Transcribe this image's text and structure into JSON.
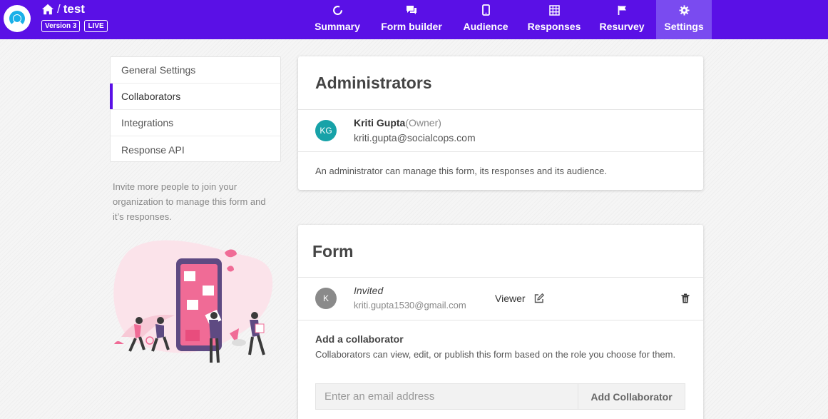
{
  "header": {
    "form_name": "test",
    "version_badge": "Version 3",
    "live_badge": "LIVE",
    "crumb_separator": "/"
  },
  "nav": [
    {
      "label": "Summary",
      "icon": "summary-icon"
    },
    {
      "label": "Form builder",
      "icon": "chat-icon"
    },
    {
      "label": "Audience",
      "icon": "phone-icon"
    },
    {
      "label": "Responses",
      "icon": "grid-icon"
    },
    {
      "label": "Resurvey",
      "icon": "flag-icon"
    },
    {
      "label": "Settings",
      "icon": "gear-icon",
      "active": true
    }
  ],
  "sidebar": {
    "items": [
      {
        "label": "General Settings"
      },
      {
        "label": "Collaborators",
        "active": true
      },
      {
        "label": "Integrations"
      },
      {
        "label": "Response API"
      }
    ],
    "invite_text": "Invite more people to join your organization to manage this form and it’s responses."
  },
  "admins": {
    "title": "Administrators",
    "owner": {
      "initials": "KG",
      "name": "Kriti Gupta",
      "role": "(Owner)",
      "email": "kriti.gupta@socialcops.com"
    },
    "note": "An administrator can manage this form, its responses and its audience."
  },
  "form": {
    "title": "Form",
    "invitee": {
      "initials": "K",
      "status": "Invited",
      "email": "kriti.gupta1530@gmail.com",
      "role": "Viewer"
    },
    "add": {
      "title": "Add a collaborator",
      "description": "Collaborators can view, edit, or publish this form based on the role you choose for them.",
      "placeholder": "Enter an email address",
      "button": "Add Collaborator"
    }
  },
  "colors": {
    "brand": "#5a10e6",
    "owner_avatar": "#17a2a8",
    "invitee_avatar": "#8a8a8a"
  }
}
